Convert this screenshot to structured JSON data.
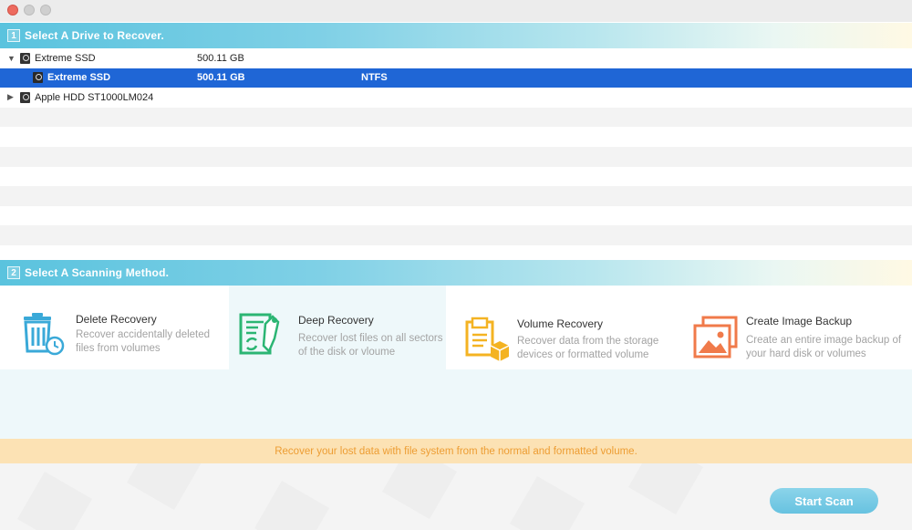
{
  "window": {
    "traffic_lights": [
      "close",
      "minimize",
      "zoom"
    ]
  },
  "section1": {
    "number": "1",
    "title": "Select A Drive to Recover."
  },
  "drives": [
    {
      "name": "Extreme SSD",
      "size": "500.11 GB",
      "fs": "",
      "expanded": true,
      "child": false,
      "selected": false
    },
    {
      "name": "Extreme SSD",
      "size": "500.11 GB",
      "fs": "NTFS",
      "expanded": false,
      "child": true,
      "selected": true
    },
    {
      "name": "Apple HDD ST1000LM024",
      "size": "",
      "fs": "",
      "expanded": false,
      "child": false,
      "selected": false
    }
  ],
  "section2": {
    "number": "2",
    "title": "Select A Scanning Method."
  },
  "methods": [
    {
      "title": "Delete Recovery",
      "desc": "Recover accidentally deleted files from volumes",
      "icon": "trash-clock-icon",
      "color": "#3aa9d8"
    },
    {
      "title": "Deep Recovery",
      "desc": "Recover lost files on all sectors of the disk or vloume",
      "icon": "document-sync-icon",
      "color": "#2bb573"
    },
    {
      "title": "Volume Recovery",
      "desc": "Recover data from the storage devices or formatted volume",
      "icon": "box-files-icon",
      "color": "#f4b322"
    },
    {
      "title": "Create Image Backup",
      "desc": "Create an entire image backup of your hard disk or volumes",
      "icon": "image-backup-icon",
      "color": "#f07a4a"
    }
  ],
  "info": {
    "text": "Recover your lost data with file system from the normal and formatted volume."
  },
  "actions": {
    "start_scan": "Start Scan"
  }
}
